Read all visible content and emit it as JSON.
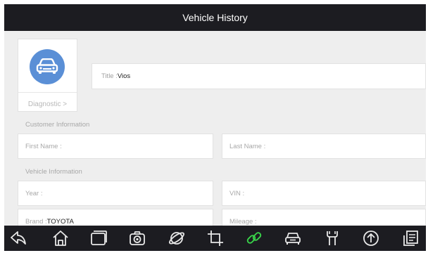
{
  "header": {
    "title": "Vehicle History"
  },
  "diagnostic": {
    "label": "Diagnostic >",
    "icon": "car-front-icon"
  },
  "title_field": {
    "label": "Title : ",
    "value": "Vios"
  },
  "customer": {
    "section_label": "Customer Information",
    "first_name_label": "First Name :",
    "last_name_label": "Last Name :"
  },
  "vehicle": {
    "section_label": "Vehicle Information",
    "year_label": "Year :",
    "vin_label": "VIN :",
    "brand_label": "Brand : ",
    "brand_value": "TOYOTA",
    "mileage_label": "Mileage :"
  },
  "nav_icons": [
    "back-icon",
    "home-icon",
    "recent-apps-icon",
    "camera-icon",
    "browser-icon",
    "crop-icon",
    "link-icon",
    "vehicle-icon",
    "tools-icon",
    "upload-icon",
    "report-icon"
  ],
  "colors": {
    "bar": "#1c1c21",
    "accent_blue": "#5a8fd6",
    "link_green": "#39d34a"
  }
}
